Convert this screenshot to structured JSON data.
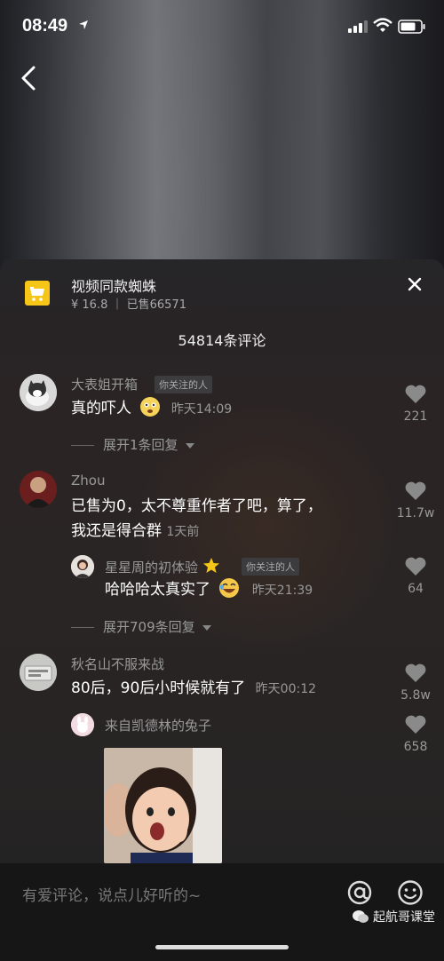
{
  "status_bar": {
    "time": "08:49"
  },
  "panel": {
    "product": {
      "name": "视频同款蜘蛛",
      "meta": "¥ 16.8 ｜ 已售66571"
    },
    "comment_count": "54814条评论",
    "comments": [
      {
        "user": "大表姐开箱",
        "tag": "你关注的人",
        "text": "真的吓人",
        "emoji": "scared-emoji",
        "time": "昨天14:09",
        "likes": "221",
        "expand": "展开1条回复"
      },
      {
        "user": "Zhou",
        "text_line1": "已售为0，太不尊重作者了吧，算了，",
        "text_line2": "我还是得合群",
        "time": "1天前",
        "likes": "11.7w",
        "reply": {
          "user": "星星周的初体验",
          "tag": "你关注的人",
          "text": "哈哈哈太真实了",
          "emoji": "laughing-emoji",
          "time": "昨天21:39",
          "likes": "64"
        },
        "expand": "展开709条回复"
      },
      {
        "user": "秋名山不服来战",
        "text": "80后，90后小时候就有了",
        "time": "昨天00:12",
        "likes": "5.8w",
        "reply": {
          "user": "来自凯德林的兔子",
          "likes": "658",
          "image": "meme-photo"
        }
      }
    ]
  },
  "input": {
    "placeholder": "有爱评论，说点儿好听的~"
  },
  "watermark": "起航哥课堂",
  "colors": {
    "shop_yellow": "#f5c518",
    "panel_bg": "#262528",
    "secondary_text": "#999999"
  }
}
